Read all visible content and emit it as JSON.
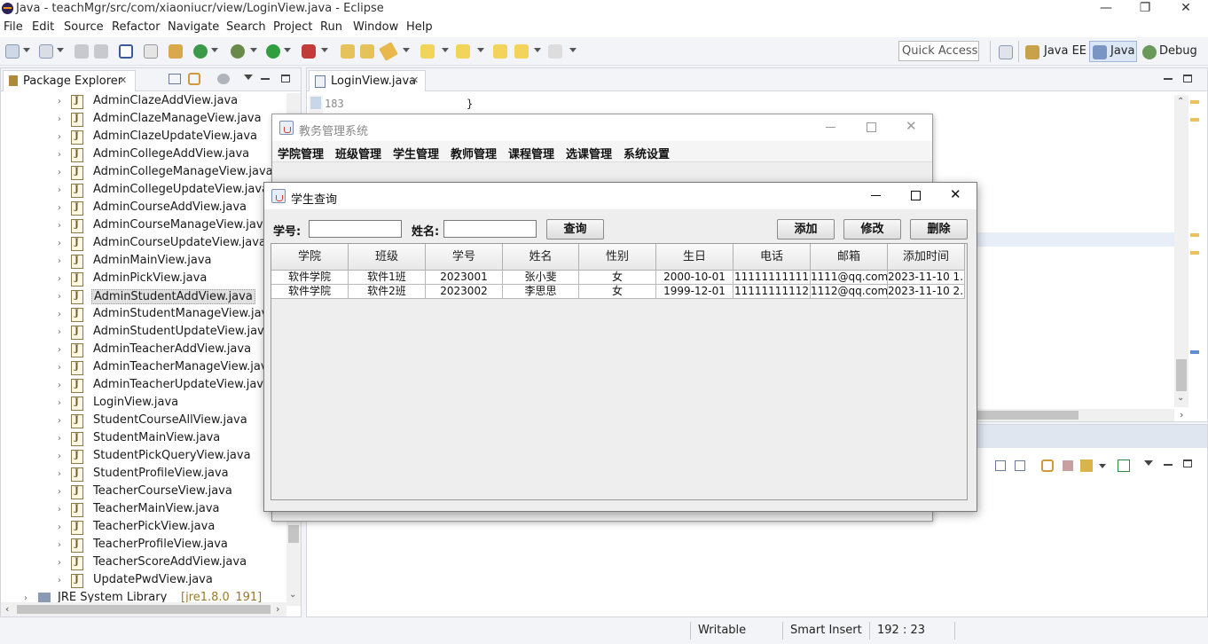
{
  "window": {
    "title": "Java - teachMgr/src/com/xiaoniucr/view/LoginView.java - Eclipse",
    "min": "—",
    "max": "❐",
    "close": "✕"
  },
  "menubar": [
    "File",
    "Edit",
    "Source",
    "Refactor",
    "Navigate",
    "Search",
    "Project",
    "Run",
    "Window",
    "Help"
  ],
  "toolbar": {
    "quick_access_placeholder": "Quick Access"
  },
  "perspectives": {
    "java_ee": "Java EE",
    "java": "Java",
    "debug": "Debug"
  },
  "package_explorer": {
    "title": "Package Explorer",
    "close": "✕",
    "files": [
      "AdminClazeAddView.java",
      "AdminClazeManageView.java",
      "AdminClazeUpdateView.java",
      "AdminCollegeAddView.java",
      "AdminCollegeManageView.java",
      "AdminCollegeUpdateView.java",
      "AdminCourseAddView.java",
      "AdminCourseManageView.java",
      "AdminCourseUpdateView.java",
      "AdminMainView.java",
      "AdminPickView.java",
      "AdminStudentAddView.java",
      "AdminStudentManageView.java",
      "AdminStudentUpdateView.java",
      "AdminTeacherAddView.java",
      "AdminTeacherManageView.java",
      "AdminTeacherUpdateView.java",
      "LoginView.java",
      "StudentCourseAllView.java",
      "StudentMainView.java",
      "StudentPickQueryView.java",
      "StudentProfileView.java",
      "TeacherCourseView.java",
      "TeacherMainView.java",
      "TeacherPickView.java",
      "TeacherProfileView.java",
      "TeacherScoreAddView.java",
      "UpdatePwdView.java"
    ],
    "selected_index": 11,
    "library": "JRE System Library",
    "library_suffix": "[jre1.8.0_191]"
  },
  "editor": {
    "tab": "LoginView.java",
    "close": "✕",
    "line_no": "183",
    "code": "}"
  },
  "status": {
    "writable": "Writable",
    "insert_mode": "Smart Insert",
    "position": "192 : 23"
  },
  "main_window": {
    "title": "教务管理系统",
    "menus": [
      "学院管理",
      "班级管理",
      "学生管理",
      "教师管理",
      "课程管理",
      "选课管理",
      "系统设置"
    ]
  },
  "dialog": {
    "title": "学生查询",
    "sno_label": "学号:",
    "name_label": "姓名:",
    "sno_value": "",
    "name_value": "",
    "buttons": {
      "query": "查询",
      "add": "添加",
      "edit": "修改",
      "delete": "删除"
    },
    "columns": [
      "学院",
      "班级",
      "学号",
      "姓名",
      "性别",
      "生日",
      "电话",
      "邮箱",
      "添加时间"
    ],
    "rows": [
      [
        "软件学院",
        "软件1班",
        "2023001",
        "张小斐",
        "女",
        "2000-10-01",
        "11111111111",
        "1111@qq.com",
        "2023-11-10 1..."
      ],
      [
        "软件学院",
        "软件2班",
        "2023002",
        "李思思",
        "女",
        "1999-12-01",
        "11111111112",
        "1112@qq.com",
        "2023-11-10 2..."
      ]
    ]
  }
}
